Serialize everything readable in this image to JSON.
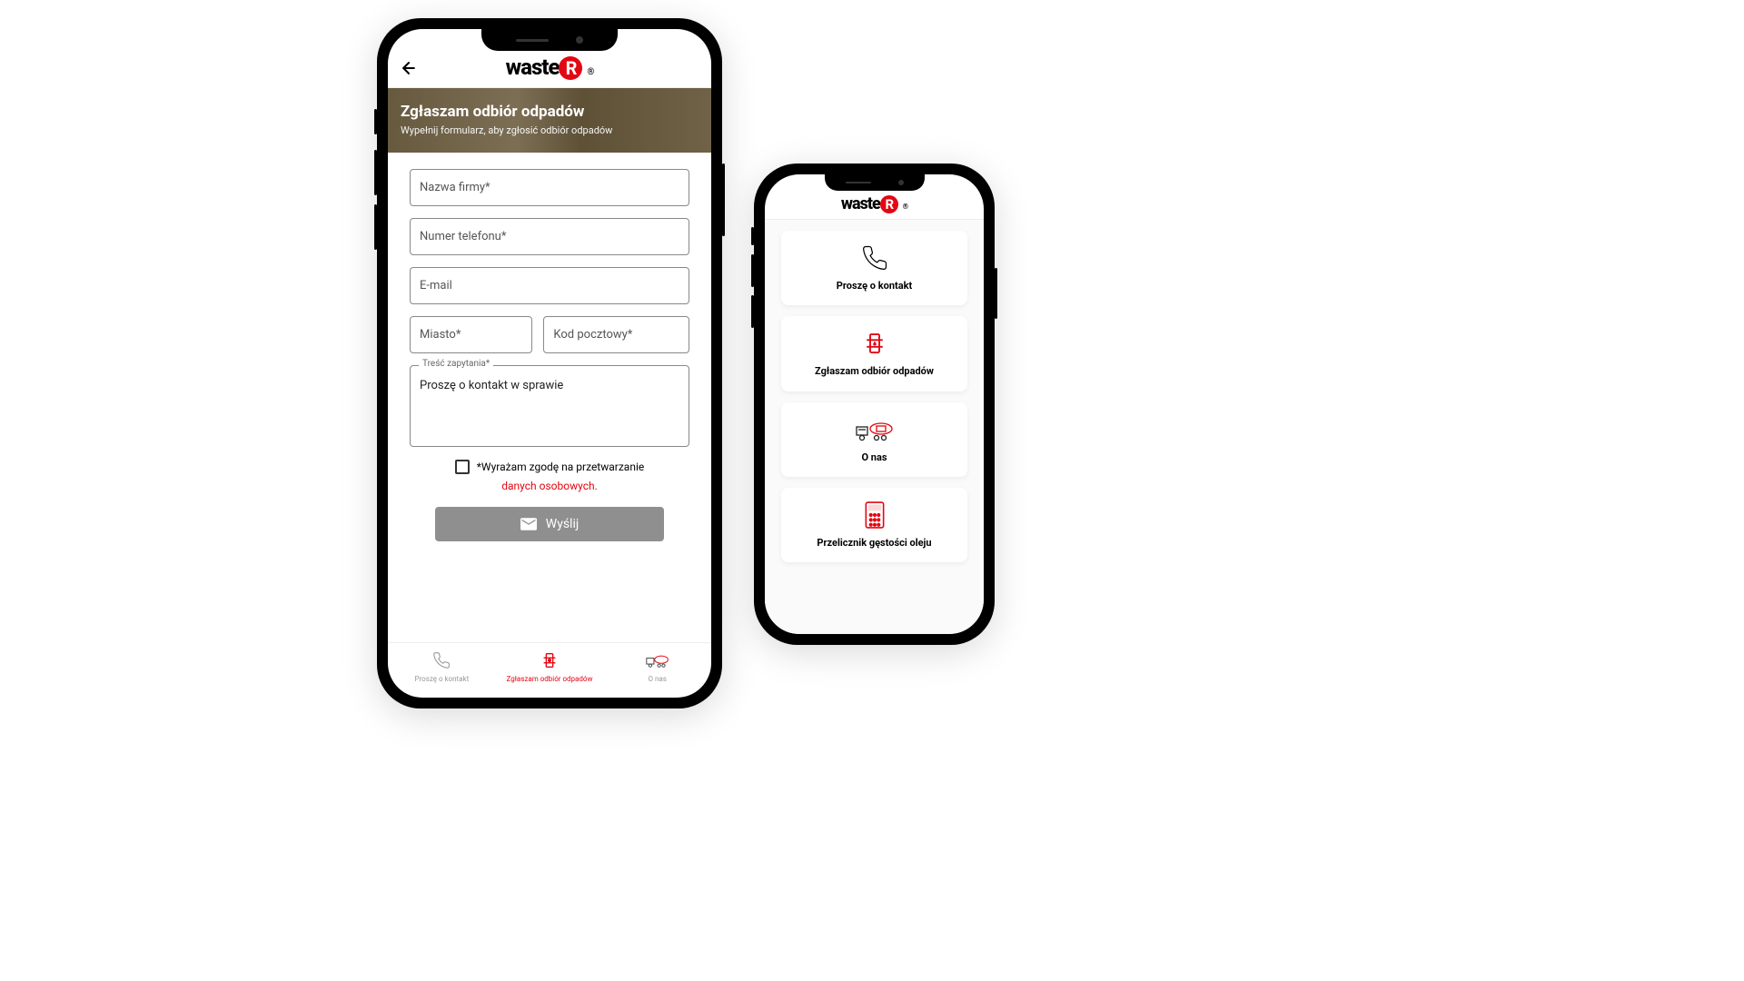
{
  "brand": {
    "name": "waste",
    "r": "R"
  },
  "hero": {
    "title": "Zgłaszam odbiór odpadów",
    "subtitle": "Wypełnij formularz, aby zgłosić odbiór odpadów"
  },
  "form": {
    "company": "Nazwa firmy*",
    "phone": "Numer telefonu*",
    "email": "E-mail",
    "city": "Miasto*",
    "postal": "Kod pocztowy*",
    "message_label": "Treść zapytania*",
    "message_value": "Proszę o kontakt w sprawie",
    "consent_text": "*Wyrażam zgodę na przetwarzanie",
    "consent_link": "danych osobowych.",
    "send": "Wyślij"
  },
  "nav": {
    "contact": "Proszę o kontakt",
    "report": "Zgłaszam odbiór odpadów",
    "about": "O nas"
  },
  "menu": {
    "contact": "Proszę o kontakt",
    "report": "Zgłaszam odbiór odpadów",
    "about": "O nas",
    "calculator": "Przelicznik gęstości oleju"
  }
}
